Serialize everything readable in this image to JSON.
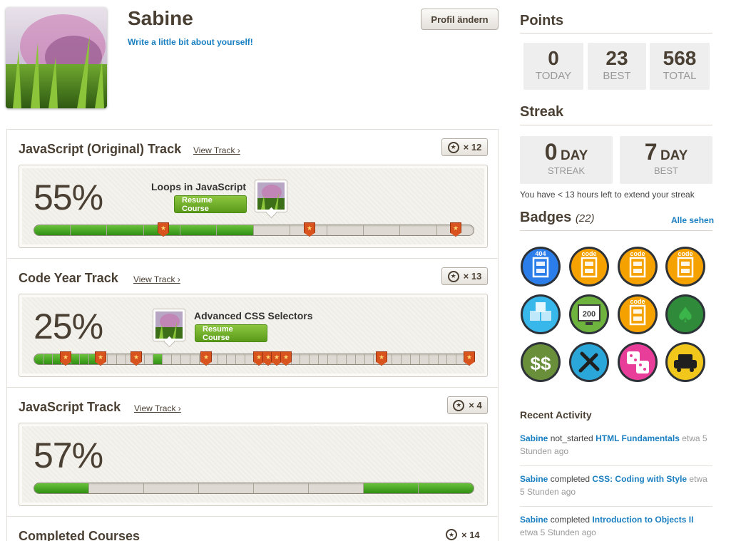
{
  "profile": {
    "name": "Sabine",
    "about": "Write a little bit about yourself!",
    "edit_label": "Profil ändern"
  },
  "tracks": [
    {
      "title": "JavaScript (Original) Track",
      "view_label": "View Track ›",
      "count": "× 12",
      "percent": "55%",
      "progress": 0.55,
      "current_course": "Loops in JavaScript",
      "resume_label": "Resume Course"
    },
    {
      "title": "Code Year Track",
      "view_label": "View Track ›",
      "count": "× 13",
      "percent": "25%",
      "progress": 0.25,
      "current_course": "Advanced CSS Selectors",
      "resume_label": "Resume Course"
    },
    {
      "title": "JavaScript Track",
      "view_label": "View Track ›",
      "count": "× 4",
      "percent": "57%",
      "progress": 0.57
    },
    {
      "title": "Completed Courses",
      "count": "× 14"
    }
  ],
  "points": {
    "title": "Points",
    "today": "0",
    "today_label": "TODAY",
    "best": "23",
    "best_label": "BEST",
    "total": "568",
    "total_label": "TOTAL"
  },
  "streak": {
    "title": "Streak",
    "current": "0",
    "current_unit": "DAY",
    "current_label": "STREAK",
    "best": "7",
    "best_unit": "DAY",
    "best_label": "BEST",
    "note": "You have < 13 hours left to extend your streak"
  },
  "badges": {
    "title": "Badges",
    "count": "(22)",
    "all_label": "Alle sehen",
    "items": [
      {
        "icon": "404-robot-icon",
        "text": "404",
        "color": "#2b7de9"
      },
      {
        "icon": "code-robot-icon",
        "text": "code",
        "color": "#f5a100"
      },
      {
        "icon": "code-robot-icon",
        "text": "code",
        "color": "#f5a100"
      },
      {
        "icon": "code-robot-icon",
        "text": "code",
        "color": "#f5a100"
      },
      {
        "icon": "ice-cubes-icon",
        "color": "#37b7ea"
      },
      {
        "icon": "monitor-200-icon",
        "text": "200",
        "color": "#6fb33f"
      },
      {
        "icon": "code-robot-icon",
        "text": "code",
        "color": "#f5a100"
      },
      {
        "icon": "spade-icon",
        "color": "#2f8a3a"
      },
      {
        "icon": "dollar-icon",
        "color": "#6a8f3a"
      },
      {
        "icon": "tools-icon",
        "color": "#2aa6d8"
      },
      {
        "icon": "dice-icon",
        "color": "#e83e9a"
      },
      {
        "icon": "taxi-icon",
        "color": "#f2c71c"
      }
    ]
  },
  "recent": {
    "title": "Recent Activity",
    "items": [
      {
        "user": "Sabine",
        "action": "not_started",
        "course": "HTML Fundamentals",
        "when": "etwa 5 Stunden ago"
      },
      {
        "user": "Sabine",
        "action": "completed",
        "course": "CSS: Coding with Style",
        "when": "etwa 5 Stunden ago"
      },
      {
        "user": "Sabine",
        "action": "completed",
        "course": "Introduction to Objects II",
        "when": "etwa 5 Stunden ago"
      }
    ]
  }
}
